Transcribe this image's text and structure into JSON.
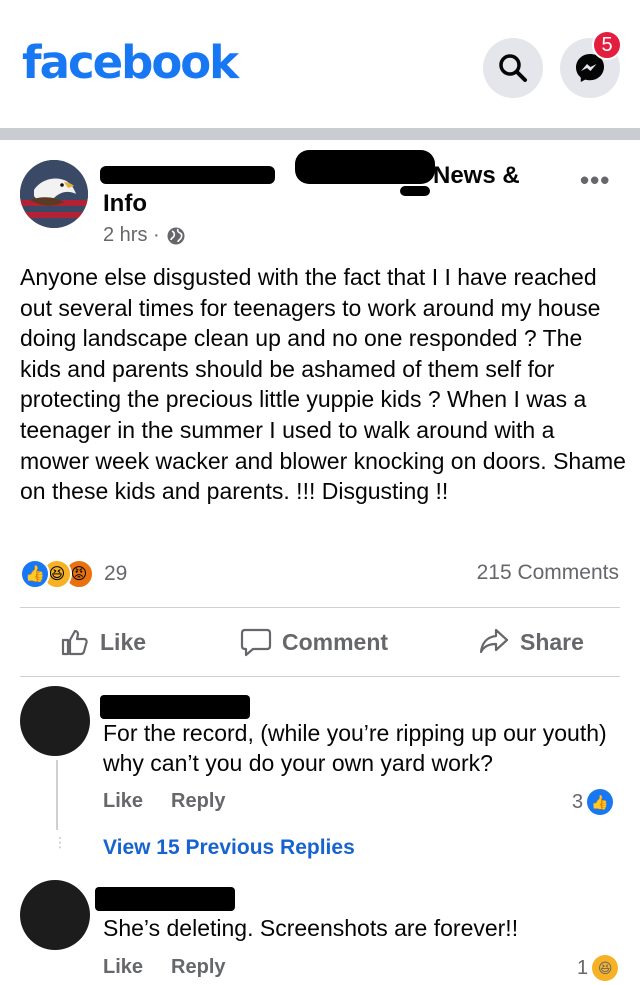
{
  "header": {
    "logo": "facebook",
    "messenger_badge": "5"
  },
  "post": {
    "author_suffix": "News &",
    "author_info": "Info",
    "time": "2 hrs ·",
    "text": "Anyone else disgusted with the fact that I I have reached out several times for teenagers to work around my house doing landscape clean up and no one responded ? The kids and parents should be ashamed of them self for protecting the precious little yuppie kids ? When I was a teenager in the summer I used to walk around with a mower week wacker and blower knocking on doors.  Shame on these kids and parents. !!! Disgusting !!",
    "reaction_count": "29",
    "comment_count": "215 Comments"
  },
  "actions": {
    "like": "Like",
    "comment": "Comment",
    "share": "Share"
  },
  "comments": [
    {
      "text": "For the record, (while you’re ripping up our youth) why can’t you do your own yard work?",
      "like": "Like",
      "reply": "Reply",
      "reaction_count": "3",
      "reaction": "like-icon"
    },
    {
      "text": "She’s deleting. Screenshots are forever!!",
      "like": "Like",
      "reply": "Reply",
      "reaction_count": "1",
      "reaction": "haha-icon"
    }
  ],
  "view_replies": "View 15 Previous Replies",
  "colors": {
    "brand": "#1877f2",
    "muted": "#65676b",
    "link": "#1763cf"
  }
}
